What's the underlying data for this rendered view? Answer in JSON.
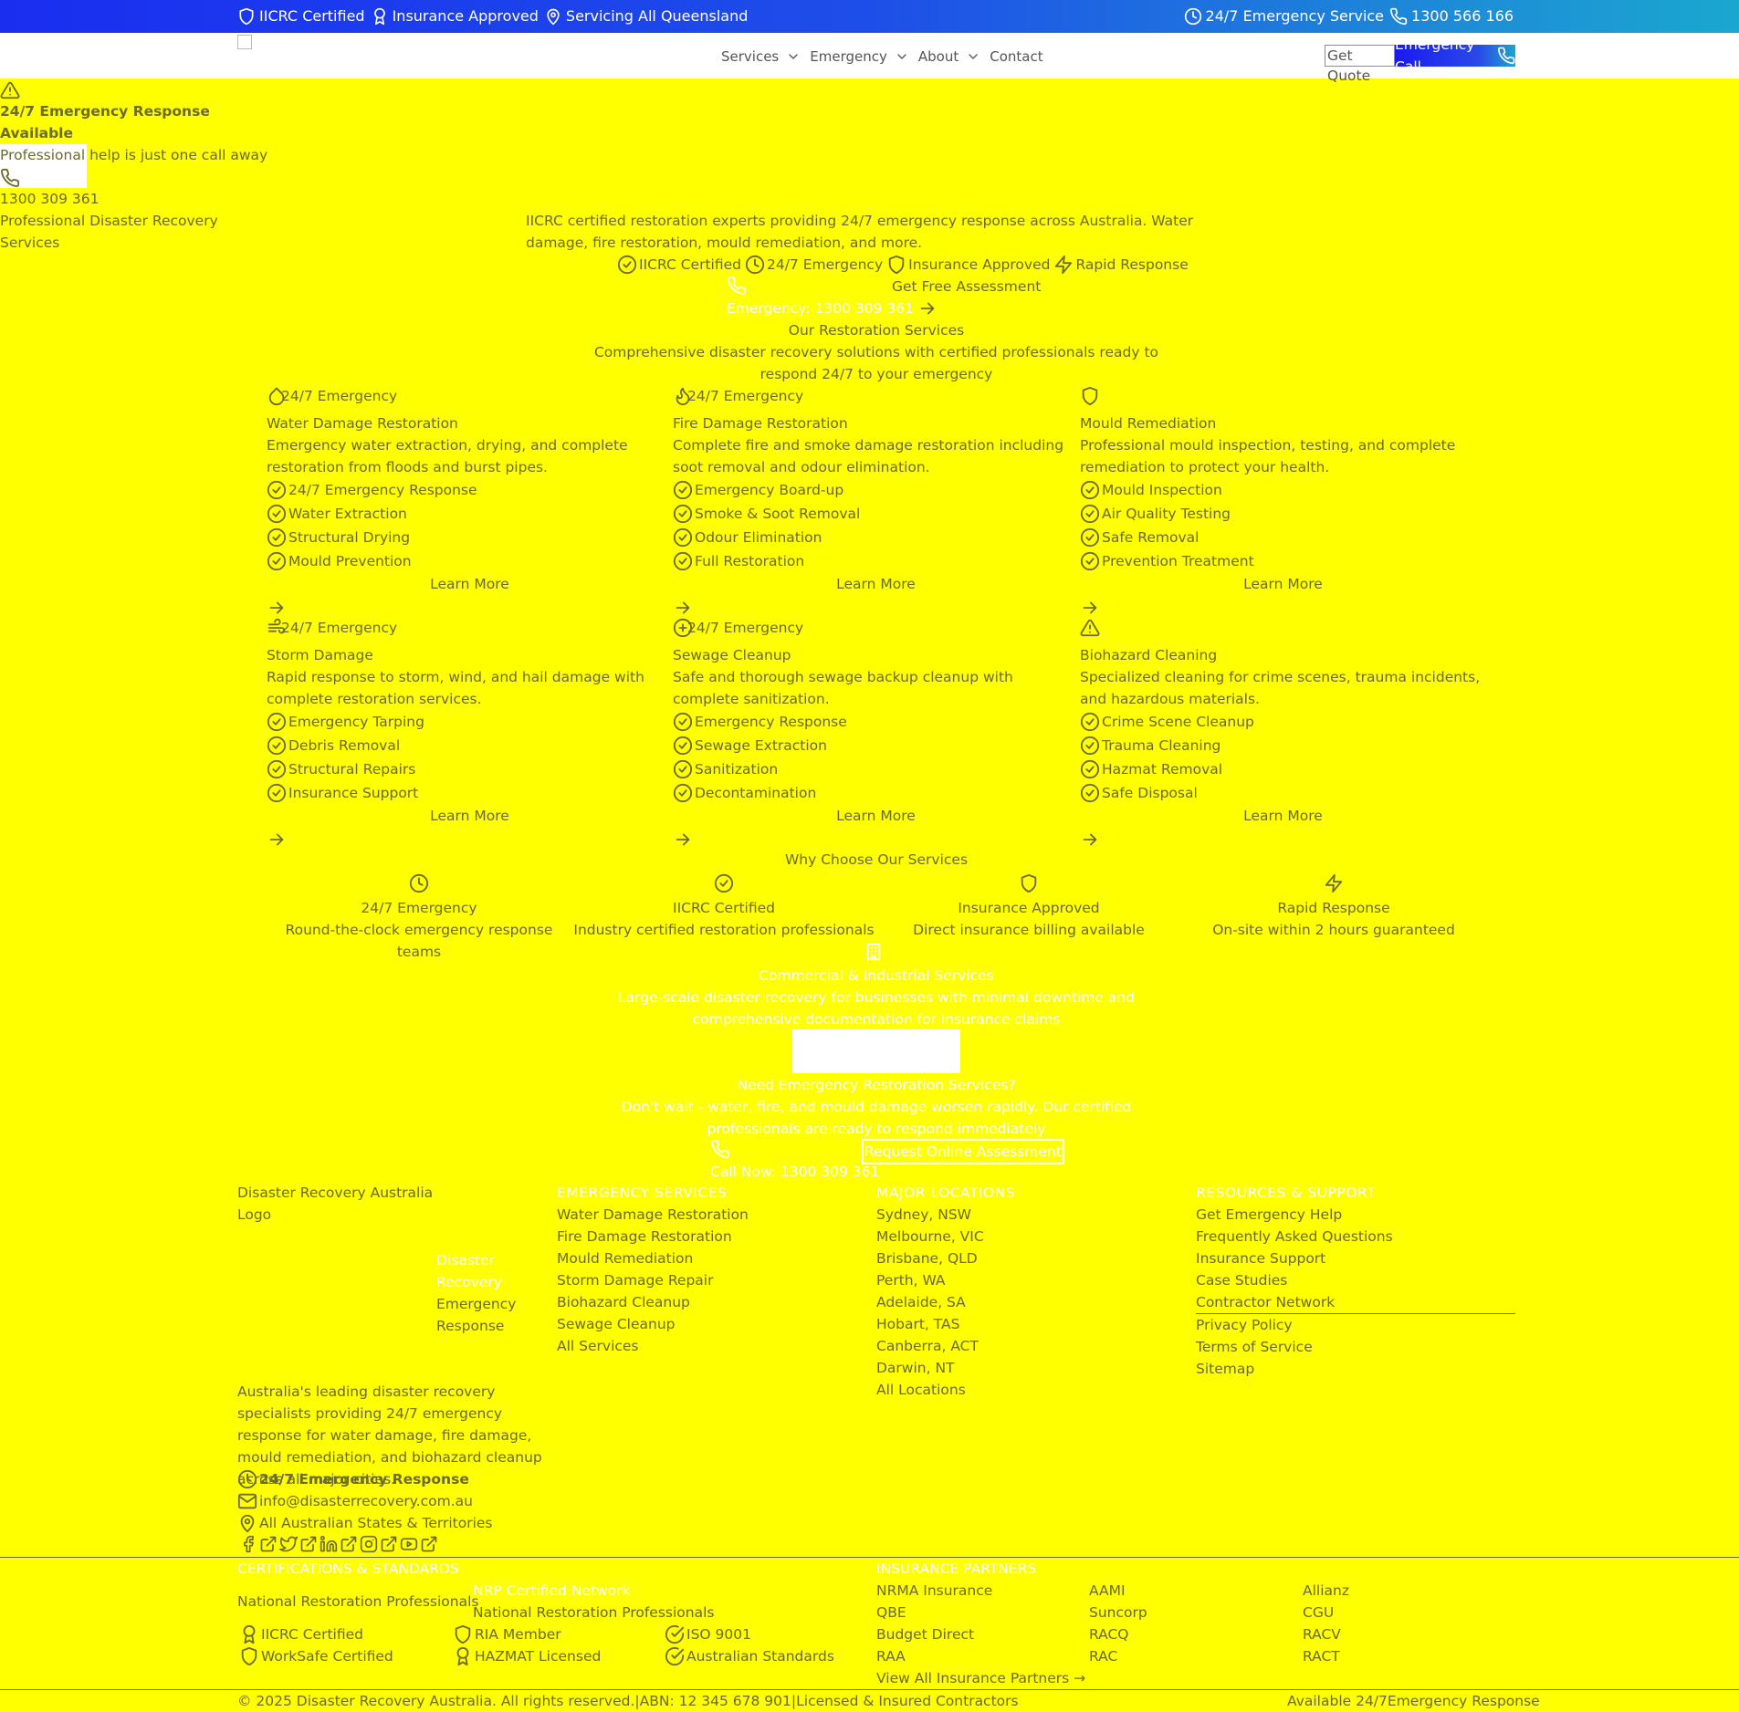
{
  "topbar": {
    "iicrc": "IICRC Certified",
    "insurance": "Insurance Approved",
    "servicing": "Servicing All Queensland",
    "emergency": "24/7 Emergency Service",
    "phone": "1300 566 166"
  },
  "nav": {
    "services": "Services",
    "emergency": "Emergency",
    "about": "About",
    "contact": "Contact",
    "quote": "Get Quote",
    "emergency_call": "Emergency Call"
  },
  "emergency_panel": {
    "title": "24/7 Emergency Response Available",
    "subtitle": "Professional help is just one call away",
    "phone": "1300 309 361",
    "tagline": "Professional Disaster Recovery Services"
  },
  "hero": {
    "description": "IICRC certified restoration experts providing 24/7 emergency response across Australia. Water damage, fire restoration, mould remediation, and more.",
    "badges": [
      "IICRC Certified",
      "24/7 Emergency",
      "Insurance Approved",
      "Rapid Response"
    ],
    "assessment": "Get Free Assessment",
    "call": "Emergency: 1300 309 361"
  },
  "services": {
    "title": "Our Restoration Services",
    "subtitle": "Comprehensive disaster recovery solutions with certified professionals ready to respond 24/7 to your emergency",
    "badge": "24/7 Emergency",
    "learn_more": "Learn More",
    "cards": [
      {
        "title": "Water Damage Restoration",
        "desc": "Emergency water extraction, drying, and complete restoration from floods and burst pipes.",
        "features": [
          "24/7 Emergency Response",
          "Water Extraction",
          "Structural Drying",
          "Mould Prevention"
        ]
      },
      {
        "title": "Fire Damage Restoration",
        "desc": "Complete fire and smoke damage restoration including soot removal and odour elimination.",
        "features": [
          "Emergency Board-up",
          "Smoke & Soot Removal",
          "Odour Elimination",
          "Full Restoration"
        ]
      },
      {
        "title": "Mould Remediation",
        "desc": "Professional mould inspection, testing, and complete remediation to protect your health.",
        "features": [
          "Mould Inspection",
          "Air Quality Testing",
          "Safe Removal",
          "Prevention Treatment"
        ]
      },
      {
        "title": "Storm Damage",
        "desc": "Rapid response to storm, wind, and hail damage with complete restoration services.",
        "features": [
          "Emergency Tarping",
          "Debris Removal",
          "Structural Repairs",
          "Insurance Support"
        ]
      },
      {
        "title": "Sewage Cleanup",
        "desc": "Safe and thorough sewage backup cleanup with complete sanitization.",
        "features": [
          "Emergency Response",
          "Sewage Extraction",
          "Sanitization",
          "Decontamination"
        ]
      },
      {
        "title": "Biohazard Cleaning",
        "desc": "Specialized cleaning for crime scenes, trauma incidents, and hazardous materials.",
        "features": [
          "Crime Scene Cleanup",
          "Trauma Cleaning",
          "Hazmat Removal",
          "Safe Disposal"
        ]
      }
    ]
  },
  "why": {
    "title": "Why Choose Our Services",
    "items": [
      {
        "title": "24/7 Emergency",
        "desc": "Round-the-clock emergency response teams"
      },
      {
        "title": "IICRC Certified",
        "desc": "Industry certified restoration professionals"
      },
      {
        "title": "Insurance Approved",
        "desc": "Direct insurance billing available"
      },
      {
        "title": "Rapid Response",
        "desc": "On-site within 2 hours guaranteed"
      }
    ]
  },
  "commercial": {
    "title": "Commercial & Industrial Services",
    "desc": "Large-scale disaster recovery for businesses with minimal downtime and comprehensive documentation for insurance claims"
  },
  "cta": {
    "title": "Need Emergency Restoration Services?",
    "desc": "Don't wait - water, fire, and mould damage worsen rapidly. Our certified professionals are ready to respond immediately",
    "call": "Call Now: 1300 309 361",
    "request": "Request Online Assessment"
  },
  "footer": {
    "logo_alt": "Disaster Recovery Australia Logo",
    "brand": [
      "Disaster Recovery",
      "Emergency",
      "Response"
    ],
    "about": "Australia's leading disaster recovery specialists providing 24/7 emergency response for water damage, fire damage, mould remediation, and biohazard cleanup across all major cities.",
    "contact": {
      "hours": "24/7 Emergency Response",
      "email": "info@disasterrecovery.com.au",
      "area": "All Australian States & Territories"
    },
    "emergency_services": {
      "heading": "Emergency Services",
      "links": [
        "Water Damage Restoration",
        "Fire Damage Restoration",
        "Mould Remediation",
        "Storm Damage Repair",
        "Biohazard Cleanup",
        "Sewage Cleanup",
        "All Services"
      ]
    },
    "locations": {
      "heading": "Major Locations",
      "links": [
        "Sydney, NSW",
        "Melbourne, VIC",
        "Brisbane, QLD",
        "Perth, WA",
        "Adelaide, SA",
        "Hobart, TAS",
        "Canberra, ACT",
        "Darwin, NT",
        "All Locations"
      ]
    },
    "resources": {
      "heading": "Resources & Support",
      "links": [
        "Get Emergency Help",
        "Frequently Asked Questions",
        "Insurance Support",
        "Case Studies",
        "Contractor Network",
        "Privacy Policy",
        "Terms of Service",
        "Sitemap"
      ]
    },
    "certifications": {
      "heading": "Certifications & Standards",
      "nrp_alt": "National Restoration Professionals",
      "nrp_network": "NRP Certified Network",
      "nrp_name": "National Restoration Professionals",
      "items": [
        "IICRC Certified",
        "RIA Member",
        "ISO 9001",
        "WorkSafe Certified",
        "HAZMAT Licensed",
        "Australian Standards"
      ]
    },
    "insurance": {
      "heading": "Insurance Partners",
      "partners": [
        "NRMA Insurance",
        "AAMI",
        "Allianz",
        "QBE",
        "Suncorp",
        "CGU",
        "Budget Direct",
        "RACQ",
        "RACV",
        "RAA",
        "RAC",
        "RACT"
      ],
      "view_all": "View All Insurance Partners →"
    },
    "copyright": "© 2025 Disaster Recovery Australia. All rights reserved.",
    "abn": "ABN: 12 345 678 901",
    "licensed": "Licensed & Insured Contractors",
    "available": "Available 24/7",
    "emergency_response": "Emergency Response"
  },
  "colors": {
    "page_bg": "#ffff00",
    "text": "#6b6b2a",
    "topbar_start": "#1a2ef0",
    "topbar_end": "#1aa7cf"
  }
}
